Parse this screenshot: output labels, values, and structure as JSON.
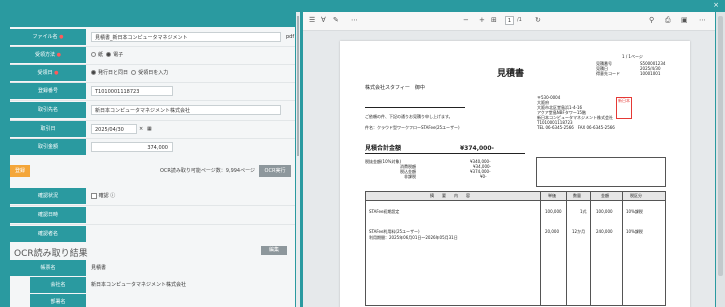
{
  "window": {
    "close_label": "×"
  },
  "form": {
    "file_label": "ファイル名",
    "file_value": "見積書_新日本コンピュータマネジメント",
    "file_ext": "pdf",
    "recv_method_label": "受領方法",
    "recv_options": [
      "紙",
      "電子"
    ],
    "recv_date_label": "受領日",
    "recv_date_options": [
      "発行日と同日",
      "受領日を入力"
    ],
    "reg_no_label": "登録番号",
    "reg_no_value": "T1010001118723",
    "partner_label": "取引先名",
    "partner_value": "新日本コンピュータマネジメント株式会社",
    "deal_date_label": "取引日",
    "deal_date_value": "2025/04/30",
    "amount_label": "取引金額",
    "amount_value": "374,000",
    "exec_label": "登録",
    "ocr_info": "OCR読み取り可能ページ数：9,994ページ",
    "ocr_btn": "OCR実行",
    "confirm_status_label": "確認状況",
    "confirm_check_label": "確認",
    "confirm_date_label": "確認日時",
    "confirmer_label": "確認者名"
  },
  "ocr_section": {
    "title": "OCR読み取り結果",
    "edit_btn": "編集",
    "rows": [
      {
        "label": "帳票名",
        "value": "見積書"
      },
      {
        "label": "会社名",
        "value": "新日本コンピュータマネジメント株式会社"
      },
      {
        "label": "部署名",
        "value": ""
      }
    ]
  },
  "viewer": {
    "tool_icons": [
      "list-icon",
      "pen-icon",
      "highlight-icon",
      "more-icon"
    ],
    "zoom_minus": "−",
    "zoom_plus": "+",
    "page_current": "1",
    "page_total": "/1",
    "search_icon": "search-icon"
  },
  "doc": {
    "title": "見積書",
    "page_no": "1 / 1ページ",
    "est_no_label": "見積番号",
    "est_no": "S500001234",
    "est_date_label": "見積日",
    "est_date": "2025/4/30",
    "cust_code_label": "得意先コード",
    "cust_code": "10001001",
    "customer": "株式会社スタフィー　御中",
    "intro": "ご依頼の件、下記の通りお見積り申し上げます。",
    "subject": "件名：クラウド型ワークフローSTAFee(25ユーザー)",
    "sender_zip": "〒530-0004",
    "sender_pref": "大阪府",
    "sender_addr1": "大阪市北区堂島浜1-4-16",
    "sender_addr2": "アクア堂島NBFタワー15階",
    "sender_company": "新日本コンピュータマネジメント株式会社",
    "sender_reg": "T1010001118723",
    "sender_tel": "TEL 06-6345-2566　FAX 06-6345-2566",
    "total_label": "見積合計金額",
    "total_value": "¥374,000-",
    "tax_label": "税抜金額(10%対象)",
    "tax_value": "¥340,000-",
    "tax_amt_label": "消費税額",
    "tax_amt": "¥34,000-",
    "incl_label": "税込金額",
    "incl_value": "¥374,000-",
    "other_label": "非課税",
    "other_value": "¥0-",
    "col_headers": [
      "摘　　要　　内　　容",
      "単価",
      "数量",
      "金額",
      "税区分"
    ],
    "items": [
      {
        "desc": "STAFee初期設定",
        "price": "100,000",
        "qty": "1式",
        "amount": "100,000",
        "tax": "10%課税"
      },
      {
        "desc": "STAFee利用料(25ユーザー)",
        "price": "20,000",
        "qty": "12か月",
        "amount": "240,000",
        "tax": "10%課税"
      }
    ],
    "period": "利用期間：2025年06月01日〜2026年05月31日",
    "stamp_text": "新日本"
  }
}
